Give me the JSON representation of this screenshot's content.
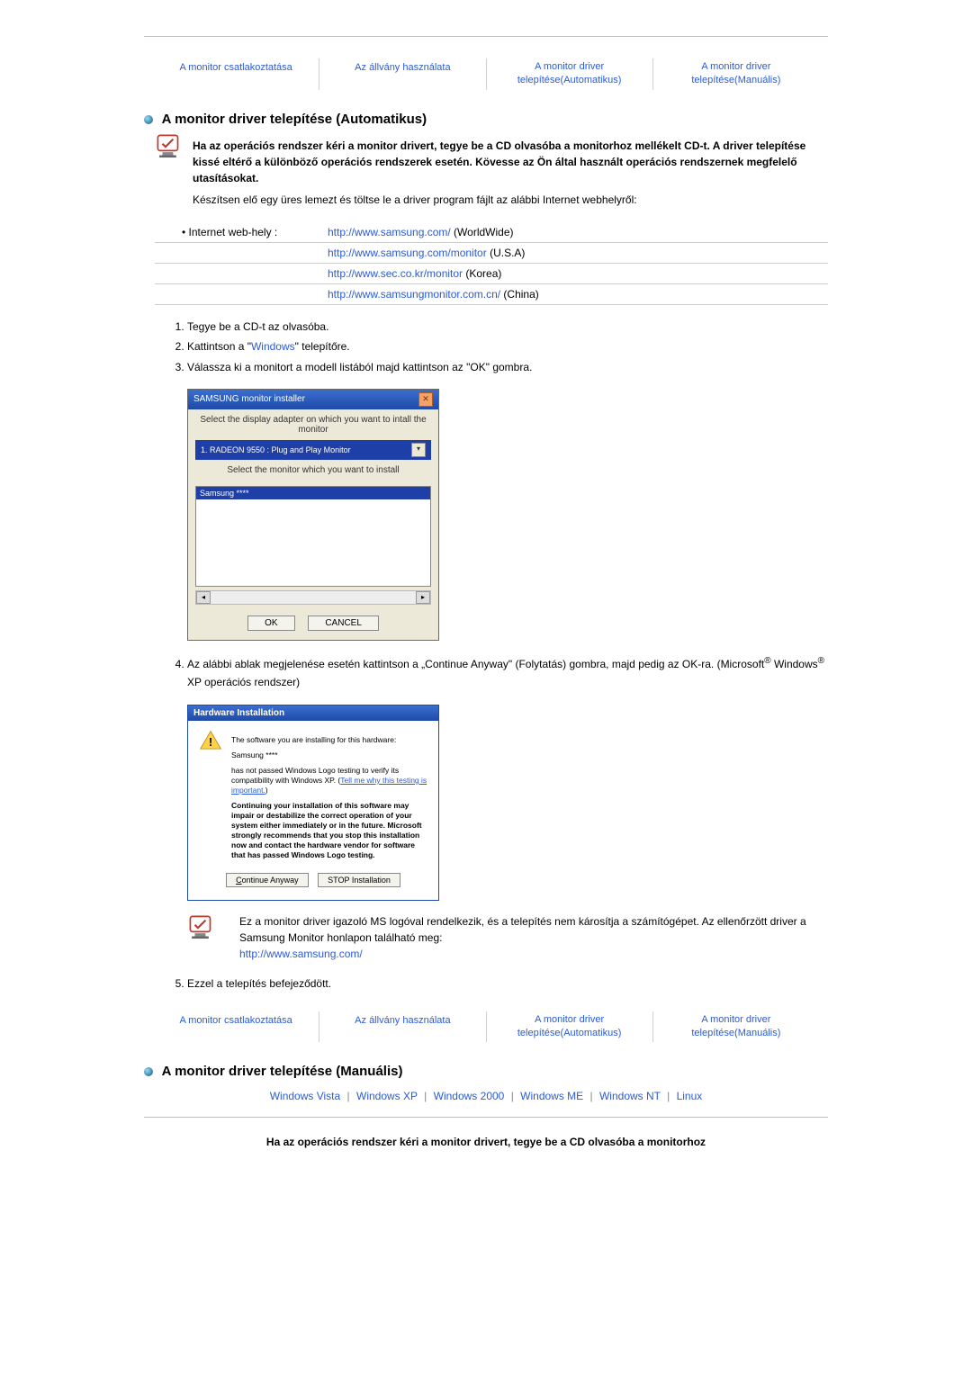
{
  "nav": [
    "A monitor csatlakoztatása",
    "Az állvány használata",
    "A monitor driver telepítése(Automatikus)",
    "A monitor driver telepítése(Manuális)"
  ],
  "autoSection": {
    "title": "A monitor driver telepítése (Automatikus)",
    "warning": "Ha az operációs rendszer kéri a monitor drivert, tegye be a CD olvasóba a monitorhoz mellékelt CD-t. A driver telepítése kissé eltérő a különböző operációs rendszerek esetén. Kövesse az Ön által használt operációs rendszernek megfelelő utasításokat.",
    "prep": "Készítsen elő egy üres lemezt és töltse le a driver program fájlt az alábbi Internet webhelyről:",
    "linktable": {
      "label": "Internet web-hely :",
      "rows": [
        {
          "url": "http://www.samsung.com/",
          "suffix": " (WorldWide)"
        },
        {
          "url": "http://www.samsung.com/monitor",
          "suffix": " (U.S.A)"
        },
        {
          "url": "http://www.sec.co.kr/monitor",
          "suffix": " (Korea)"
        },
        {
          "url": "http://www.samsungmonitor.com.cn/",
          "suffix": " (China)"
        }
      ]
    },
    "steps": {
      "s1": "Tegye be a CD-t az olvasóba.",
      "s2a": "Kattintson a \"",
      "s2link": "Windows",
      "s2b": "\" telepítőre.",
      "s3": "Válassza ki a monitort a modell listából majd kattintson az \"OK\" gombra.",
      "s4a": "Az alábbi ablak megjelenése esetén kattintson a „Continue Anyway\" (Folytatás) gombra, majd pedig az OK-ra. (Microsoft",
      "s4b": " Windows",
      "s4c": " XP operációs rendszer)",
      "s5": "Ezzel a telepítés befejeződött."
    },
    "installer": {
      "title": "SAMSUNG monitor installer",
      "instr1": "Select the display adapter on which you want to intall the monitor",
      "combo": "1. RADEON 9550 : Plug and Play Monitor",
      "instr2": "Select the monitor which you want to install",
      "selected": "Samsung ****",
      "ok": "OK",
      "cancel": "CANCEL"
    },
    "hwdlg": {
      "title": "Hardware Installation",
      "line1": "The software you are installing for this hardware:",
      "line2": "Samsung ****",
      "line3a": "has not passed Windows Logo testing to verify its compatibility with Windows XP. (",
      "line3link": "Tell me why this testing is important.",
      "line3b": ")",
      "line4": "Continuing your installation of this software may impair or destabilize the correct operation of your system either immediately or in the future. Microsoft strongly recommends that you stop this installation now and contact the hardware vendor for software that has passed Windows Logo testing.",
      "btn1": "Continue Anyway",
      "btn2": "STOP Installation"
    },
    "note": {
      "text": "Ez a monitor driver igazoló MS logóval rendelkezik, és a telepítés nem károsítja a számítógépet. Az ellenőrzött driver a Samsung Monitor honlapon található meg:",
      "link": "http://www.samsung.com/"
    }
  },
  "manualSection": {
    "title": "A monitor driver telepítése (Manuális)",
    "oslinks": [
      "Windows Vista",
      "Windows XP",
      "Windows 2000",
      "Windows ME",
      "Windows NT",
      "Linux"
    ],
    "footer": "Ha az operációs rendszer kéri a monitor drivert, tegye be a CD olvasóba a monitorhoz"
  },
  "sep": "|"
}
